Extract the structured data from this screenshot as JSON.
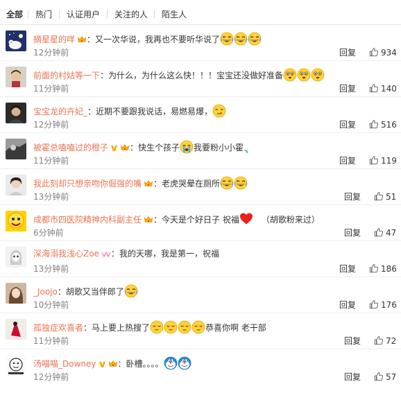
{
  "tabs": [
    "全部",
    "热门",
    "认证用户",
    "关注的人",
    "陌生人"
  ],
  "actions": {
    "reply_label": "回复"
  },
  "colors": {
    "username": "#eb7350",
    "text": "#333333",
    "time": "#808080"
  },
  "comments": [
    {
      "user": "摘星星的咩",
      "text": "：又一次华说，我再也不要听华说了",
      "time": "12分钟前",
      "likes": "934",
      "emoji": "laugh-cry-emoji"
    },
    {
      "user": "前面的村姑等一下",
      "text": "：为什么，为什么这么快！！！宝宝还没做好准备",
      "time": "11分钟前",
      "likes": "140",
      "emoji": "worried-face-emoji"
    },
    {
      "user": "宝宝龙的卉妃_",
      "text": "：近期不要跟我说话，易燃易爆，",
      "time": "12分钟前",
      "likes": "516",
      "emoji": "smirk-emoji"
    },
    {
      "user": "被霍总嗑嗑过的橙子",
      "text": "：快生个孩子",
      "text2": "我要粉小小霍",
      "time": "11分钟前",
      "likes": "119",
      "emoji": "crying-face-emoji"
    },
    {
      "user": "我此刻却只想亲吻你倔强的嘴",
      "text": "：老虎哭晕在厕所",
      "time": "13分钟前",
      "likes": "51",
      "emoji": "laugh-cry-emoji"
    },
    {
      "user": "成都市四医院精神内科副主任",
      "text": "：今天是个好日子  祝福",
      "text2": "（胡歌粉来过）",
      "time": "6分钟前",
      "likes": "47",
      "emoji": "heart-emoji"
    },
    {
      "user": "深海溺我浅心Zoe",
      "text": "：我的天哪，我是第一，祝福",
      "time": "13分钟前",
      "likes": "186"
    },
    {
      "user": "_Joojo",
      "text": "：胡歌又当伴郎了",
      "time": "10分钟前",
      "likes": "176",
      "emoji": "laugh-cry-emoji"
    },
    {
      "user": "孤独症欢喜者",
      "text": "：马上要上热搜了",
      "text2": "恭喜你啊 老干部",
      "time": "11分钟前",
      "likes": "72",
      "emoji": "relieved-face-emoji"
    },
    {
      "user": "汤喵喵_Downey",
      "text": "：卧槽。。。。",
      "time": "12分钟前",
      "likes": "57",
      "emoji": "doraemon-emoji"
    }
  ]
}
